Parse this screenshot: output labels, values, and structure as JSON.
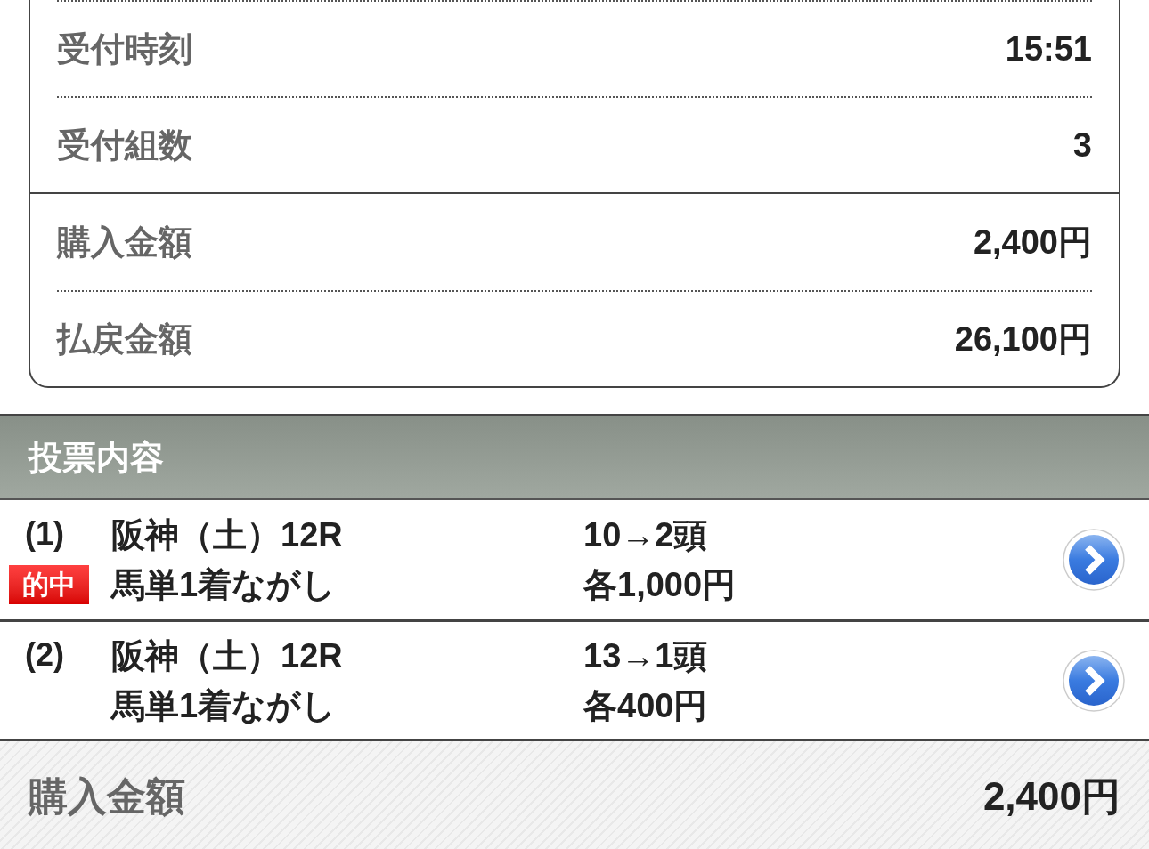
{
  "summary_groups": [
    [
      {
        "label": "受付時刻",
        "value": "15:51"
      },
      {
        "label": "受付組数",
        "value": "3"
      }
    ],
    [
      {
        "label": "購入金額",
        "value": "2,400円"
      },
      {
        "label": "払戻金額",
        "value": "26,100円"
      }
    ]
  ],
  "section_title": "投票内容",
  "hit_label": "的中",
  "bets": [
    {
      "number": "(1)",
      "race": "阪神（土）12R",
      "type": "馬単1着ながし",
      "combo": "10→2頭",
      "amount": "各1,000円",
      "hit": true
    },
    {
      "number": "(2)",
      "race": "阪神（土）12R",
      "type": "馬単1着ながし",
      "combo": "13→1頭",
      "amount": "各400円",
      "hit": false
    }
  ],
  "footer": {
    "label": "購入金額",
    "value": "2,400円"
  }
}
